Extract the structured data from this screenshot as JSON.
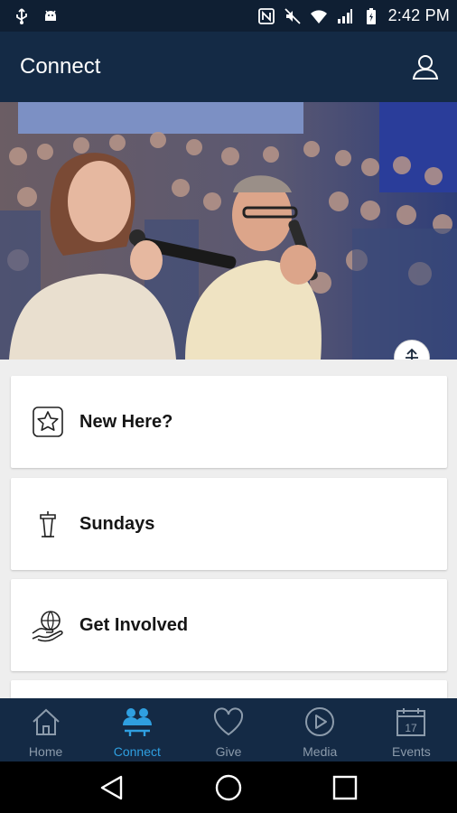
{
  "status_bar": {
    "time": "2:42 PM",
    "icons": [
      "usb-icon",
      "android-debug-icon",
      "nfc-icon",
      "mute-icon",
      "wifi-icon",
      "signal-icon",
      "battery-charging-icon"
    ]
  },
  "header": {
    "title": "Connect",
    "profile_icon": "person-icon"
  },
  "hero": {
    "image": "worship-singers-photo",
    "badge_icon": "church-logo-icon"
  },
  "list": {
    "items": [
      {
        "label": "New Here?",
        "icon": "star-badge-icon"
      },
      {
        "label": "Sundays",
        "icon": "podium-icon"
      },
      {
        "label": "Get Involved",
        "icon": "hand-globe-icon"
      }
    ]
  },
  "tabs": [
    {
      "label": "Home",
      "icon": "home-icon",
      "active": false
    },
    {
      "label": "Connect",
      "icon": "people-icon",
      "active": true
    },
    {
      "label": "Give",
      "icon": "heart-icon",
      "active": false
    },
    {
      "label": "Media",
      "icon": "play-icon",
      "active": false
    },
    {
      "label": "Events",
      "icon": "calendar-icon",
      "active": false,
      "calendar_day": "17"
    }
  ],
  "system_nav": [
    "back-icon",
    "home-circle-icon",
    "recents-icon"
  ],
  "colors": {
    "status_bar": "#0f1f33",
    "header": "#142a45",
    "tab_active": "#2f9fe0",
    "tab_inactive": "#8c9bab",
    "card_bg": "#ffffff",
    "list_bg": "#eeeeee"
  }
}
